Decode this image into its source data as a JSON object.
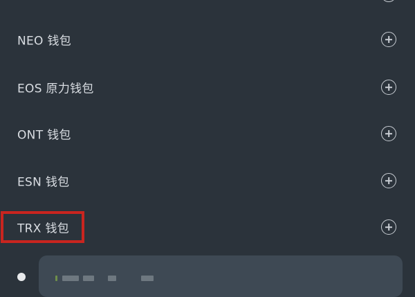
{
  "wallet_list": {
    "items": [
      {
        "label": "NEO 钱包"
      },
      {
        "label": "EOS 原力钱包"
      },
      {
        "label": "ONT 钱包"
      },
      {
        "label": "ESN 钱包"
      },
      {
        "label": "TRX 钱包"
      }
    ]
  },
  "icons": {
    "add": "plus-circle-icon"
  },
  "colors": {
    "background": "#2b333b",
    "highlight": "#c9251f",
    "card": "#3e4954"
  }
}
